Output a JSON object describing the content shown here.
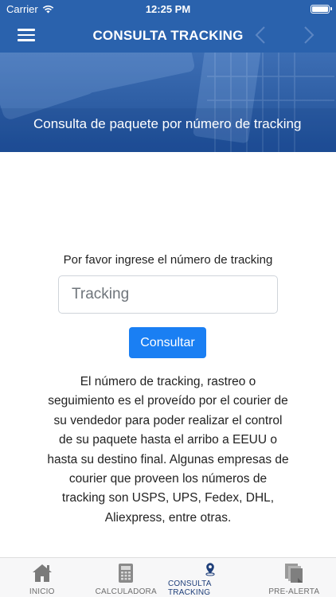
{
  "status_bar": {
    "carrier": "Carrier",
    "time": "12:25 PM"
  },
  "nav": {
    "title": "CONSULTA TRACKING",
    "menu_icon": "hamburger-menu-icon",
    "back_icon": "chevron-left-icon",
    "forward_icon": "chevron-right-icon"
  },
  "banner": {
    "text": "Consulta de paquete por número de tracking"
  },
  "form": {
    "prompt": "Por favor ingrese el número de tracking",
    "input_placeholder": "Tracking",
    "input_value": "",
    "button_label": "Consultar"
  },
  "info": {
    "text": "El número de tracking, rastreo o seguimiento es el proveído por el courier de su vendedor para poder realizar el control de su paquete hasta el arribo a EEUU o hasta su destino final. Algunas empresas de courier que proveen los números de tracking son USPS, UPS, Fedex, DHL, Aliexpress, entre otras."
  },
  "tabs": [
    {
      "label": "INICIO",
      "icon": "home-icon",
      "active": false
    },
    {
      "label": "CALCULADORA",
      "icon": "calculator-icon",
      "active": false
    },
    {
      "label": "CONSULTA TRACKING",
      "icon": "location-pin-icon",
      "active": true
    },
    {
      "label": "PRE-ALERTA",
      "icon": "documents-icon",
      "active": false
    }
  ],
  "colors": {
    "primary": "#2a62ad",
    "button": "#1a7ff3",
    "active_tab": "#1f3f7a",
    "inactive_tab": "#8e8e8e"
  }
}
